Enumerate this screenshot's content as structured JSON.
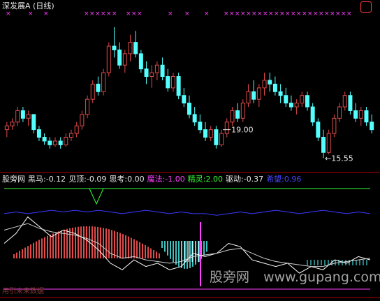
{
  "chart_data": [
    {
      "type": "candlestick",
      "title": "深发展A (日线)",
      "annotations": [
        {
          "label": "19.00",
          "marker": "←",
          "x": 40
        },
        {
          "label": "←15.55",
          "x": 101
        }
      ],
      "ylim": [
        15.3,
        19.2
      ],
      "candles": [
        [
          16.3,
          16.5,
          16.1,
          16.4
        ],
        [
          16.4,
          16.6,
          16.3,
          16.5
        ],
        [
          16.5,
          16.9,
          16.4,
          16.8
        ],
        [
          16.8,
          16.9,
          16.5,
          16.6
        ],
        [
          16.6,
          16.8,
          16.4,
          16.7
        ],
        [
          16.7,
          16.7,
          16.2,
          16.3
        ],
        [
          16.3,
          16.4,
          16.0,
          16.1
        ],
        [
          16.1,
          16.2,
          15.9,
          16.0
        ],
        [
          16.0,
          16.1,
          15.8,
          15.9
        ],
        [
          15.9,
          16.1,
          15.85,
          16.0
        ],
        [
          16.0,
          16.1,
          15.8,
          15.9
        ],
        [
          15.9,
          16.2,
          15.85,
          16.1
        ],
        [
          16.1,
          16.3,
          16.0,
          16.2
        ],
        [
          16.2,
          16.5,
          16.1,
          16.4
        ],
        [
          16.4,
          16.8,
          16.3,
          16.7
        ],
        [
          16.7,
          17.2,
          16.6,
          17.1
        ],
        [
          17.1,
          17.6,
          17.0,
          17.5
        ],
        [
          17.5,
          17.7,
          17.2,
          17.3
        ],
        [
          17.3,
          17.9,
          17.2,
          17.8
        ],
        [
          17.8,
          18.6,
          17.7,
          18.5
        ],
        [
          18.5,
          19.0,
          18.2,
          18.4
        ],
        [
          18.4,
          18.6,
          17.9,
          18.0
        ],
        [
          18.0,
          18.4,
          17.8,
          18.3
        ],
        [
          18.3,
          18.8,
          18.1,
          18.6
        ],
        [
          18.6,
          18.9,
          18.2,
          18.3
        ],
        [
          18.3,
          18.4,
          17.8,
          17.9
        ],
        [
          17.9,
          18.1,
          17.5,
          17.7
        ],
        [
          17.7,
          18.0,
          17.4,
          17.8
        ],
        [
          17.8,
          18.1,
          17.6,
          18.0
        ],
        [
          18.0,
          18.2,
          17.6,
          17.7
        ],
        [
          17.7,
          17.9,
          17.3,
          17.4
        ],
        [
          17.4,
          17.8,
          17.3,
          17.7
        ],
        [
          17.7,
          17.8,
          17.1,
          17.2
        ],
        [
          17.2,
          17.4,
          16.9,
          17.0
        ],
        [
          17.0,
          17.2,
          16.6,
          16.7
        ],
        [
          16.7,
          16.9,
          16.4,
          16.5
        ],
        [
          16.5,
          16.7,
          16.2,
          16.3
        ],
        [
          16.3,
          16.5,
          16.0,
          16.1
        ],
        [
          16.1,
          16.4,
          16.0,
          16.3
        ],
        [
          16.3,
          16.4,
          15.8,
          15.9
        ],
        [
          15.9,
          16.3,
          15.85,
          16.2
        ],
        [
          16.2,
          16.6,
          16.1,
          16.5
        ],
        [
          16.5,
          16.9,
          16.4,
          16.8
        ],
        [
          16.8,
          17.0,
          16.5,
          16.6
        ],
        [
          16.6,
          17.1,
          16.5,
          17.0
        ],
        [
          17.0,
          17.5,
          16.9,
          17.3
        ],
        [
          17.3,
          17.6,
          17.0,
          17.1
        ],
        [
          17.1,
          17.5,
          16.9,
          17.4
        ],
        [
          17.4,
          17.8,
          17.2,
          17.6
        ],
        [
          17.6,
          17.8,
          17.3,
          17.5
        ],
        [
          17.5,
          17.7,
          17.2,
          17.3
        ],
        [
          17.3,
          17.5,
          17.0,
          17.2
        ],
        [
          17.2,
          17.4,
          16.9,
          17.0
        ],
        [
          17.0,
          17.2,
          16.8,
          16.9
        ],
        [
          16.9,
          17.1,
          16.7,
          17.0
        ],
        [
          17.0,
          17.3,
          16.9,
          17.2
        ],
        [
          17.2,
          17.3,
          16.8,
          16.9
        ],
        [
          16.9,
          17.0,
          16.4,
          16.5
        ],
        [
          16.5,
          16.6,
          16.0,
          16.1
        ],
        [
          16.1,
          16.3,
          15.55,
          15.7
        ],
        [
          15.7,
          16.3,
          15.65,
          16.2
        ],
        [
          16.2,
          16.7,
          16.1,
          16.6
        ],
        [
          16.6,
          17.0,
          16.5,
          16.9
        ],
        [
          16.9,
          17.3,
          16.8,
          17.2
        ],
        [
          17.2,
          17.3,
          16.7,
          16.8
        ],
        [
          16.8,
          17.0,
          16.5,
          16.6
        ],
        [
          16.6,
          16.9,
          16.4,
          16.8
        ],
        [
          16.8,
          16.9,
          16.4,
          16.5
        ],
        [
          16.5,
          16.7,
          16.2,
          16.3
        ]
      ]
    },
    {
      "type": "line",
      "series": [
        {
          "name": "精灵",
          "color": "#ffffff",
          "y": [
            0.1,
            0.4,
            0.9,
            0.6,
            0.3,
            0.5,
            0.4,
            0.2,
            -0.1,
            -0.5,
            -0.7,
            -0.4,
            -0.6,
            -0.5,
            -0.7,
            -0.6,
            -0.2,
            -0.3,
            -0.2,
            0.1,
            0.0,
            -0.4,
            -0.5,
            -0.6,
            -0.5,
            -0.8,
            -0.6,
            -0.7,
            -0.4,
            -0.5,
            -0.3,
            -0.4
          ]
        },
        {
          "name": "思考",
          "color": "#d0d0d0",
          "y": [
            0.5,
            0.6,
            0.7,
            0.55,
            0.45,
            0.4,
            0.35,
            0.25,
            0.1,
            -0.2,
            -0.35,
            -0.3,
            -0.4,
            -0.45,
            -0.5,
            -0.45,
            -0.3,
            -0.25,
            -0.2,
            -0.1,
            -0.05,
            -0.2,
            -0.35,
            -0.45,
            -0.5,
            -0.55,
            -0.6,
            -0.6,
            -0.5,
            -0.45,
            -0.4,
            -0.35
          ]
        },
        {
          "name": "驱动",
          "color": "#3a3aff",
          "y": [
            1.0,
            1.05,
            1.0,
            1.05,
            1.1,
            1.05,
            1.1,
            1.05,
            1.1,
            1.05,
            1.0,
            1.05,
            1.1,
            1.05,
            1.0,
            1.05,
            1.0,
            1.0,
            0.95,
            1.0,
            1.05,
            1.0,
            1.05,
            1.1,
            1.05,
            1.0,
            1.05,
            1.1,
            1.05,
            1.0,
            1.05,
            1.0
          ]
        }
      ],
      "ylim": [
        -1.2,
        1.8
      ]
    }
  ],
  "header": {
    "title": "深发展A (日线)",
    "marker_glyph": "×"
  },
  "indicator": {
    "items": [
      {
        "label": "股旁网",
        "value": "",
        "color": "#e6e6e6"
      },
      {
        "label": "黑马:",
        "value": "-0.12",
        "color": "#e6e6e6"
      },
      {
        "label": "见顶:",
        "value": "-0.09",
        "color": "#e6e6e6"
      },
      {
        "label": "思考:",
        "value": "0.00",
        "color": "#e6e6e6"
      },
      {
        "label": "魔法:",
        "value": "-1.00",
        "color": "#ff40ff"
      },
      {
        "label": "精灵:",
        "value": "2.00",
        "color": "#33ff33"
      },
      {
        "label": "驱动:",
        "value": "-0.37",
        "color": "#e6e6e6"
      },
      {
        "label": "希望:",
        "value": "0.96",
        "color": "#4444ff"
      }
    ]
  },
  "footer": {
    "label": "用引未来数据"
  },
  "watermark": {
    "cn": "股旁网",
    "url": "www.gupang.com"
  },
  "colors": {
    "up": "#e04a4a",
    "down": "#54ffff",
    "magenta": "#ff40ff",
    "green": "#33ff33",
    "blue": "#3a3aff",
    "axis": "#b00000"
  }
}
